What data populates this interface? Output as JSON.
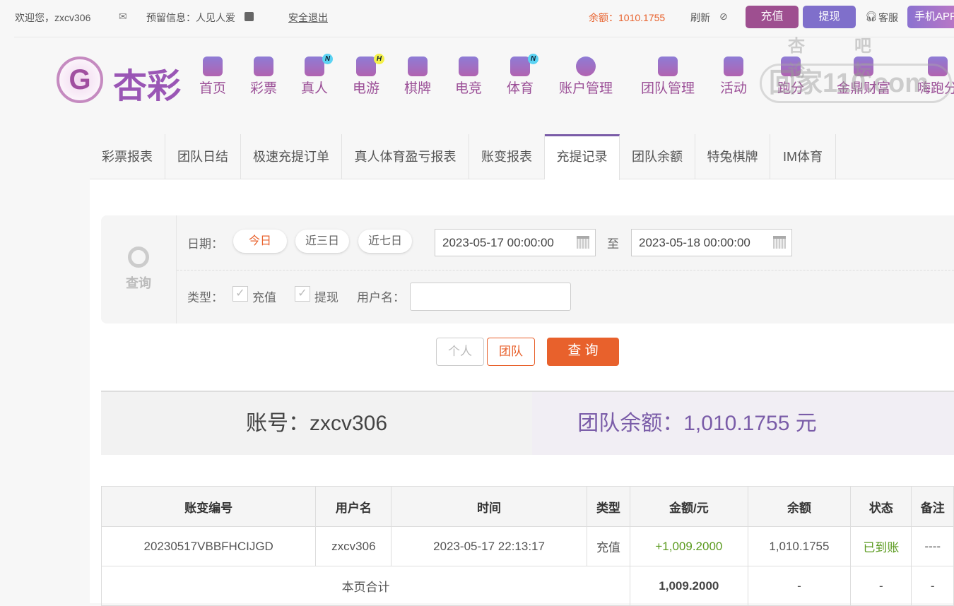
{
  "topbar": {
    "welcome": "欢迎您，zxcv306",
    "reserved_info": "预留信息：人见人爱",
    "logout": "安全退出",
    "balance": "余额：1010.1755",
    "refresh": "刷新",
    "deposit": "充值",
    "withdraw": "提现",
    "service": "客服",
    "app": "手机APP"
  },
  "logo": {
    "text": "杏彩"
  },
  "nav": [
    {
      "label": "首页"
    },
    {
      "label": "彩票"
    },
    {
      "label": "真人",
      "badge": "N"
    },
    {
      "label": "电游",
      "badge": "H"
    },
    {
      "label": "棋牌"
    },
    {
      "label": "电竞"
    },
    {
      "label": "体育",
      "badge": "N"
    },
    {
      "label": "账户管理"
    },
    {
      "label": "团队管理"
    },
    {
      "label": "活动"
    },
    {
      "label": "跑分"
    },
    {
      "label": "金鼎财富"
    },
    {
      "label": "嗨跑分"
    }
  ],
  "watermark": {
    "line1": "杏吧论坛",
    "line2": "回家110.com"
  },
  "tabs": [
    "彩票报表",
    "团队日结",
    "极速充提订单",
    "真人体育盈亏报表",
    "账变报表",
    "充提记录",
    "团队余额",
    "特兔棋牌",
    "IM体育"
  ],
  "filter": {
    "search_label": "查询",
    "date_label": "日期：",
    "today": "今日",
    "three_days": "近三日",
    "seven_days": "近七日",
    "start": "2023-05-17 00:00:00",
    "to": "至",
    "end": "2023-05-18 00:00:00",
    "type_label": "类型：",
    "type_deposit": "充值",
    "type_withdraw": "提现",
    "username_label": "用户名：",
    "username_value": ""
  },
  "buttons": {
    "personal": "个人",
    "team": "团队",
    "query": "查 询"
  },
  "summary": {
    "account": "账号：zxcv306",
    "team_balance": "团队余额：1,010.1755 元"
  },
  "table": {
    "headers": [
      "账变编号",
      "用户名",
      "时间",
      "类型",
      "金额/元",
      "余额",
      "状态",
      "备注"
    ],
    "rows": [
      [
        "20230517VBBFHCIJGD",
        "zxcv306",
        "2023-05-17 22:13:17",
        "充值",
        "+1,009.2000",
        "1,010.1755",
        "已到账",
        "----"
      ]
    ],
    "total": {
      "label": "本页合计",
      "amount": "1,009.2000",
      "balance": "-",
      "status": "-",
      "note": "-"
    }
  },
  "colors": {
    "accent": "#7a5ca8",
    "orange": "#e8612c",
    "green": "#5a9a1e"
  }
}
